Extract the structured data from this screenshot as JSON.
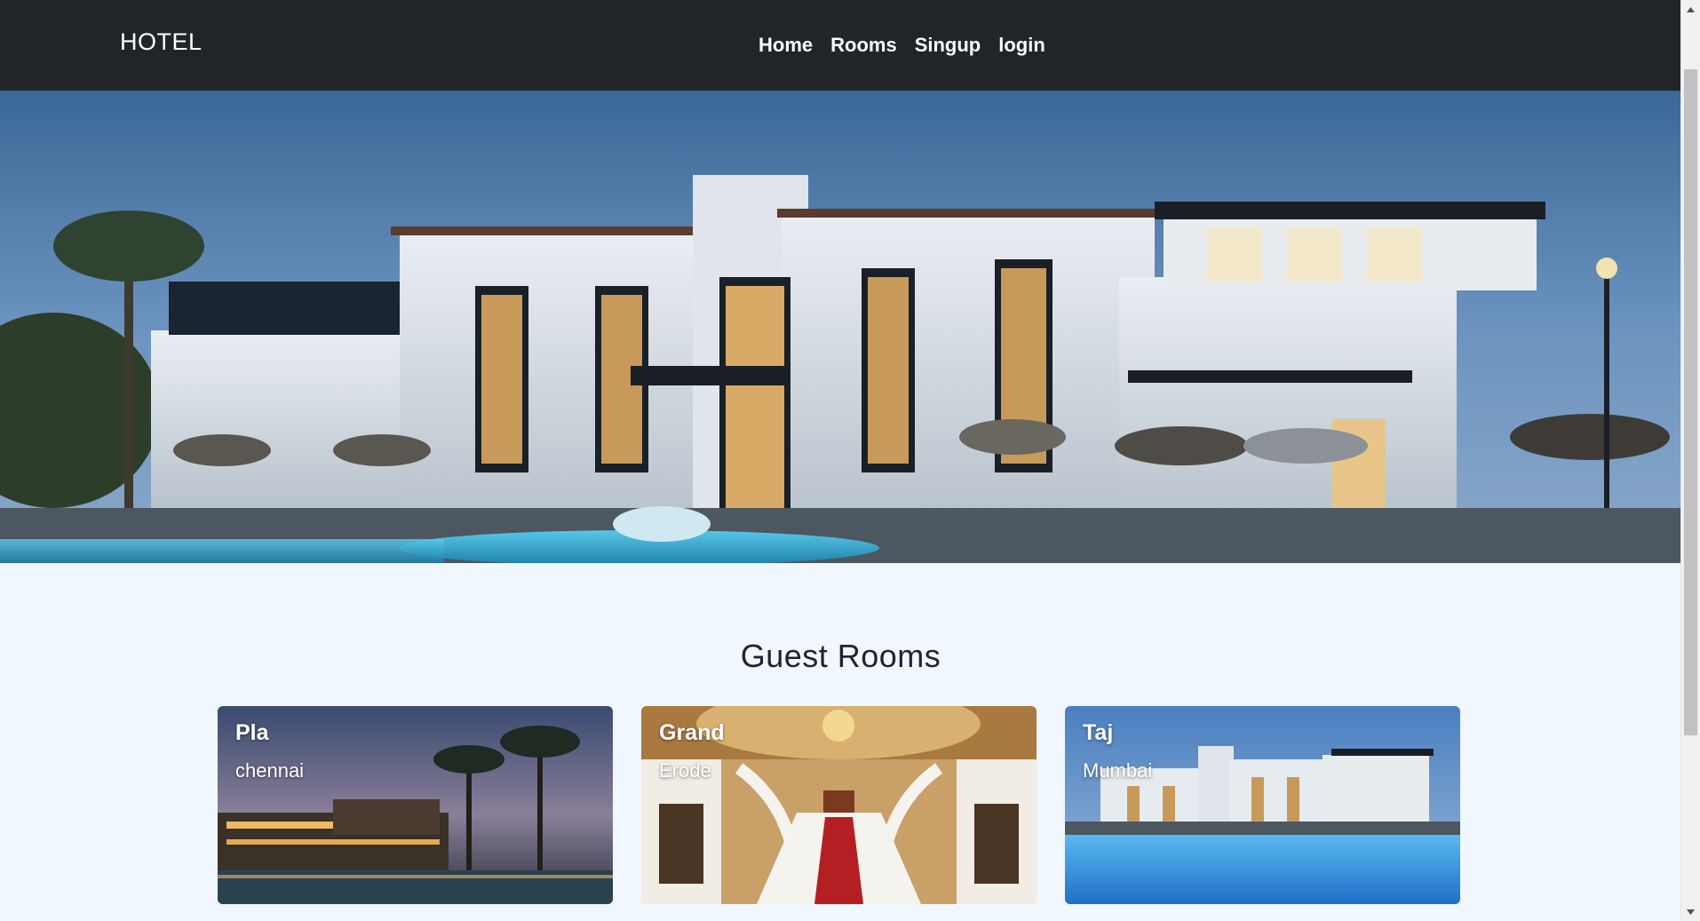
{
  "navbar": {
    "brand": "HOTEL",
    "links": [
      {
        "label": "Home"
      },
      {
        "label": "Rooms"
      },
      {
        "label": "Singup"
      },
      {
        "label": "login"
      }
    ]
  },
  "hero": {
    "image": "hotel-exterior-photo"
  },
  "guest_rooms": {
    "title": "Guest Rooms",
    "cards": [
      {
        "name": "Pla",
        "location": "chennai",
        "image": "tropical-resort-photo"
      },
      {
        "name": "Grand",
        "location": "Erode",
        "image": "grand-staircase-photo"
      },
      {
        "name": "Taj",
        "location": "Mumbai",
        "image": "hotel-pool-photo"
      }
    ]
  },
  "colors": {
    "navbar_bg": "#212529",
    "page_bg": "#f0f7ff",
    "text_light": "#ffffff",
    "title_text": "#212529"
  }
}
